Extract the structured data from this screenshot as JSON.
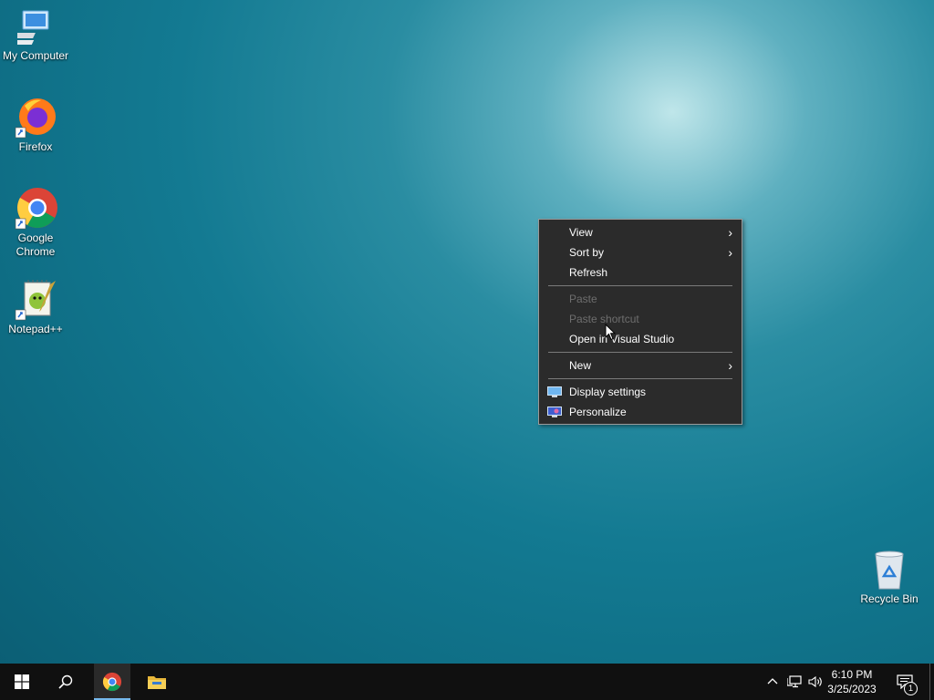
{
  "desktop": {
    "icons": [
      {
        "label": "My Computer"
      },
      {
        "label": "Firefox"
      },
      {
        "label": "Google Chrome"
      },
      {
        "label": "Notepad++"
      },
      {
        "label": "Recycle Bin"
      }
    ]
  },
  "context_menu": {
    "items": [
      {
        "label": "View",
        "submenu": true,
        "enabled": true
      },
      {
        "label": "Sort by",
        "submenu": true,
        "enabled": true
      },
      {
        "label": "Refresh",
        "enabled": true
      },
      {
        "label": "Paste",
        "enabled": false
      },
      {
        "label": "Paste shortcut",
        "enabled": false
      },
      {
        "label": "Open in Visual Studio",
        "enabled": true
      },
      {
        "label": "New",
        "submenu": true,
        "enabled": true
      },
      {
        "label": "Display settings",
        "icon": "display-icon",
        "enabled": true
      },
      {
        "label": "Personalize",
        "icon": "personalize-icon",
        "enabled": true
      }
    ]
  },
  "taskbar": {
    "clock": {
      "time": "6:10 PM",
      "date": "3/25/2023"
    },
    "notification_count": "1"
  }
}
